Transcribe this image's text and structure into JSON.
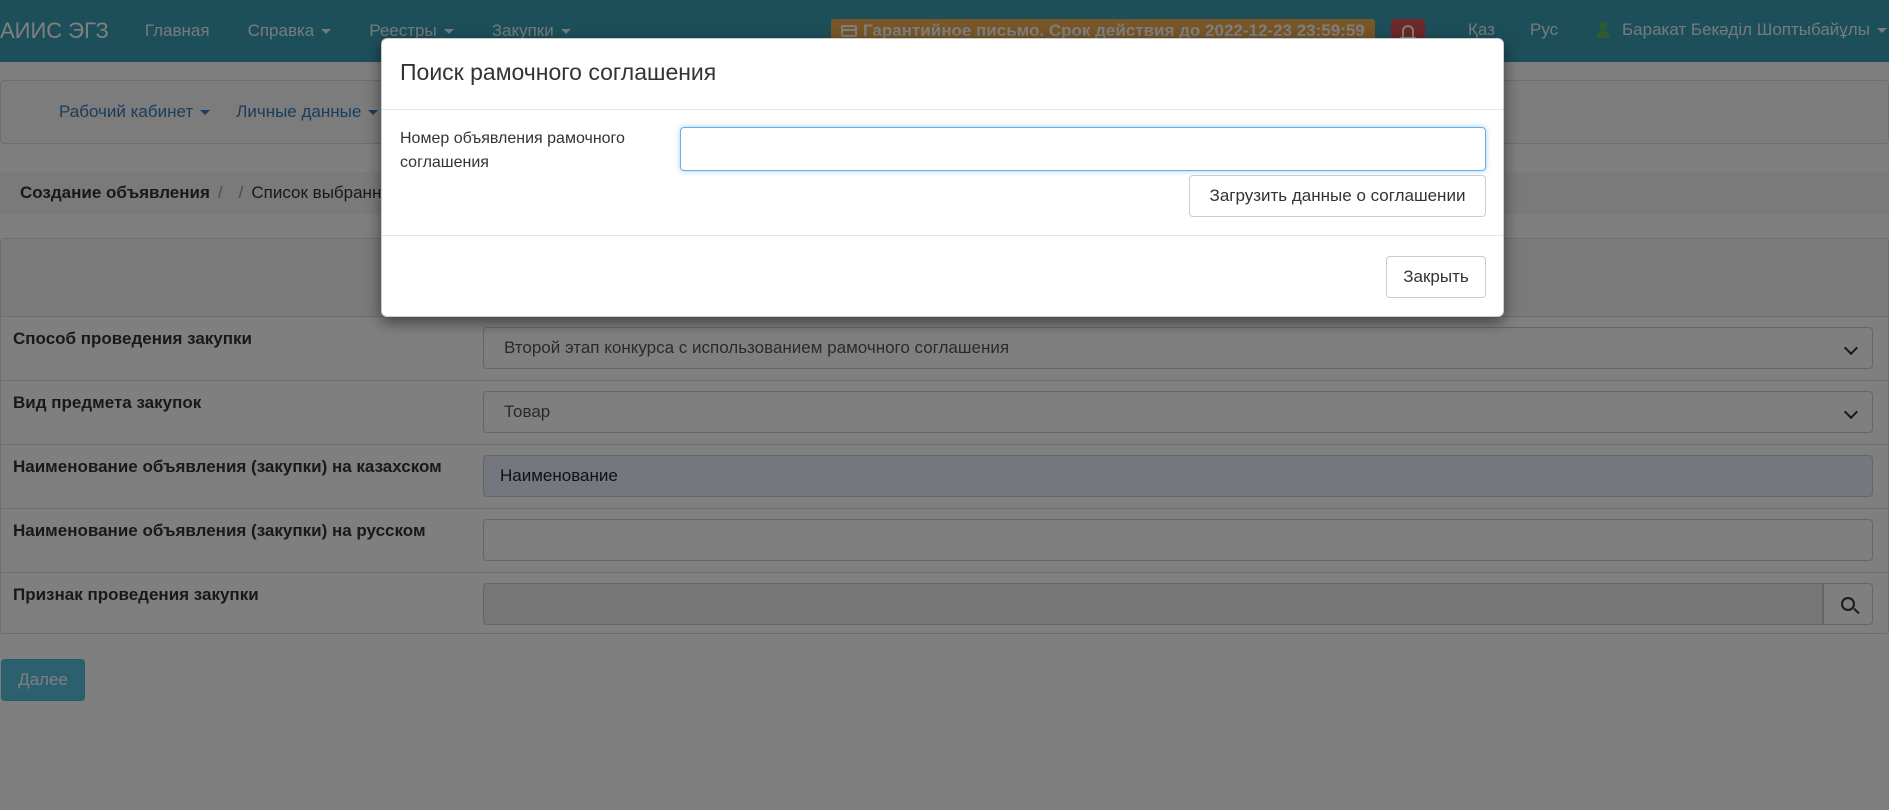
{
  "navbar": {
    "brand": "АИИС ЭГЗ",
    "items": [
      "Главная",
      "Справка",
      "Реестры",
      "Закупки"
    ],
    "guarantee": "Гарантийное письмо. Срок действия до 2022-12-23 23:59:59",
    "langs": [
      "Қаз",
      "Рус"
    ],
    "user": "Баракат Бекәділ Шоптыбайұлы",
    "accent": "#3a9fb5"
  },
  "subnav": {
    "items": [
      "Рабочий кабинет",
      "Личные данные"
    ]
  },
  "breadcrumb": {
    "active": "Создание объявления",
    "separator": "/",
    "next": "Список выбранных"
  },
  "form": {
    "rows": [
      {
        "label": "Способ проведения закупки",
        "value": "Второй этап конкурса с использованием рамочного соглашения"
      },
      {
        "label": "Вид предмета закупок",
        "value": "Товар"
      },
      {
        "label": "Наименование объявления (закупки) на казахском",
        "value": "Наименование"
      },
      {
        "label": "Наименование объявления (закупки) на русском",
        "value": ""
      },
      {
        "label": "Признак проведения закупки",
        "value": ""
      }
    ],
    "next_label": "Далее"
  },
  "modal": {
    "title": "Поиск рамочного соглашения",
    "field_label": "Номер объявления рамочного соглашения",
    "input_value": "",
    "load_label": "Загрузить данные о соглашении",
    "close_label": "Закрыть"
  }
}
